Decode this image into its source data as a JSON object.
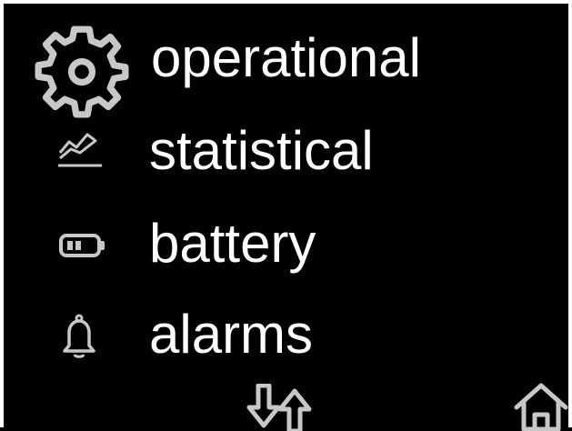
{
  "menu": {
    "items": [
      {
        "label": "operational",
        "icon": "gear-icon"
      },
      {
        "label": "statistical",
        "icon": "trend-chart-icon"
      },
      {
        "label": "battery",
        "icon": "battery-icon"
      },
      {
        "label": "alarms",
        "icon": "bell-icon"
      }
    ]
  },
  "footer": {
    "scroll_icon": "down-up-arrows-icon",
    "home_icon": "home-icon"
  },
  "colors": {
    "background": "#000000",
    "text": "#ffffff",
    "icon_gray": "#c8c8c8"
  }
}
